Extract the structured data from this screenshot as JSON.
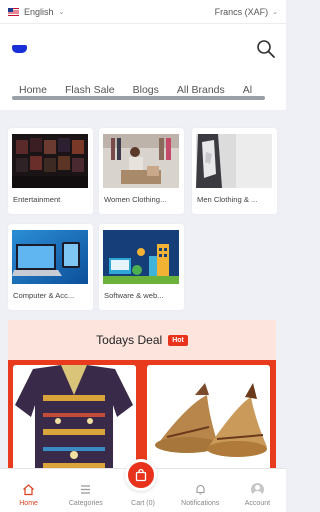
{
  "topbar": {
    "language": "English",
    "currency": "Francs (XAF)"
  },
  "nav": {
    "tabs": [
      "Home",
      "Flash Sale",
      "Blogs",
      "All Brands",
      "Al"
    ]
  },
  "categories": [
    {
      "label": "Entertainment"
    },
    {
      "label": "Women Clothing..."
    },
    {
      "label": "Men Clothing & ..."
    },
    {
      "label": "Computer & Acc..."
    },
    {
      "label": "Software & web..."
    }
  ],
  "deal": {
    "title": "Todays Deal",
    "badge": "Hot"
  },
  "bottom_nav": {
    "home": "Home",
    "categories": "Categories",
    "cart": "Cart (0)",
    "notifications": "Notifications",
    "account": "Account"
  },
  "colors": {
    "accent": "#e8321c",
    "brand": "#1a2fd6"
  }
}
